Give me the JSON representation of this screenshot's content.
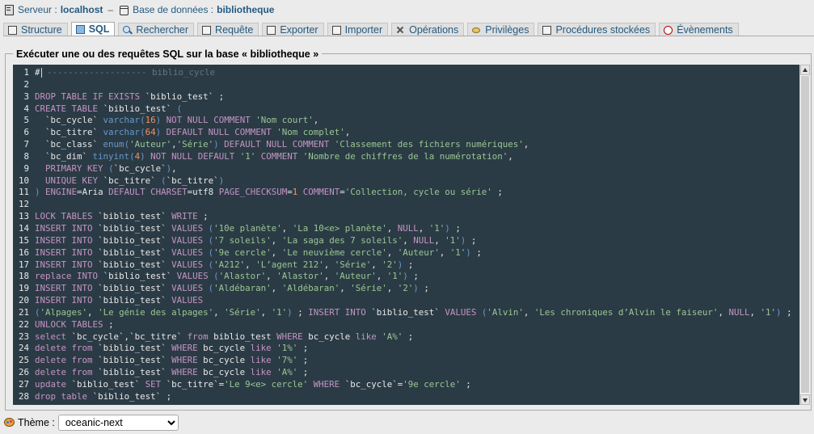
{
  "breadcrumb": {
    "server_label": "Serveur :",
    "server_value": "localhost",
    "db_label": "Base de données :",
    "db_value": "bibliotheque",
    "separator": "–"
  },
  "tabs": [
    {
      "label": "Structure",
      "icon": "structure-icon"
    },
    {
      "label": "SQL",
      "icon": "sql-icon",
      "active": true
    },
    {
      "label": "Rechercher",
      "icon": "search-icon"
    },
    {
      "label": "Requête",
      "icon": "query-icon"
    },
    {
      "label": "Exporter",
      "icon": "export-icon"
    },
    {
      "label": "Importer",
      "icon": "import-icon"
    },
    {
      "label": "Opérations",
      "icon": "operations-icon"
    },
    {
      "label": "Privilèges",
      "icon": "privileges-icon"
    },
    {
      "label": "Procédures stockées",
      "icon": "routines-icon"
    },
    {
      "label": "Évènements",
      "icon": "events-icon"
    }
  ],
  "panel": {
    "legend": "Exécuter une ou des requêtes SQL sur la base « bibliotheque »"
  },
  "editor": {
    "lines": [
      "# ------------------- biblio_cycle",
      "",
      "DROP TABLE IF EXISTS `biblio_test` ;",
      "CREATE TABLE `biblio_test` (",
      "  `bc_cycle` varchar(16) NOT NULL COMMENT 'Nom court',",
      "  `bc_titre` varchar(64) DEFAULT NULL COMMENT 'Nom complet',",
      "  `bc_class` enum('Auteur','Série') DEFAULT NULL COMMENT 'Classement des fichiers numériques',",
      "  `bc_dim` tinyint(4) NOT NULL DEFAULT '1' COMMENT 'Nombre de chiffres de la numérotation',",
      "  PRIMARY KEY (`bc_cycle`),",
      "  UNIQUE KEY `bc_titre` (`bc_titre`)",
      ") ENGINE=Aria DEFAULT CHARSET=utf8 PAGE_CHECKSUM=1 COMMENT='Collection, cycle ou série' ;",
      "",
      "LOCK TABLES `biblio_test` WRITE ;",
      "INSERT INTO `biblio_test` VALUES ('10e planète', 'La 10<e> planète', NULL, '1') ;",
      "INSERT INTO `biblio_test` VALUES ('7 soleils', 'La saga des 7 soleils', NULL, '1') ;",
      "INSERT INTO `biblio_test` VALUES ('9e cercle', 'Le neuvième cercle', 'Auteur', '1') ;",
      "INSERT INTO `biblio_test` VALUES ('A212', 'L’agent 212', 'Série', '2') ;",
      "replace INTO `biblio_test` VALUES ('Alastor', 'Alastor', 'Auteur', '1') ;",
      "INSERT INTO `biblio_test` VALUES ('Aldébaran', 'Aldébaran', 'Série', '2') ;",
      "INSERT INTO `biblio_test` VALUES",
      "('Alpages', 'Le génie des alpages', 'Série', '1') ; INSERT INTO `biblio_test` VALUES ('Alvin', 'Les chroniques d’Alvin le faiseur', NULL, '1') ;",
      "UNLOCK TABLES ;",
      "select `bc_cycle`,`bc_titre` from biblio_test WHERE bc_cycle like 'A%' ;",
      "delete from `biblio_test` WHERE bc_cycle like '1%' ;",
      "delete from `biblio_test` WHERE bc_cycle like '7%' ;",
      "delete from `biblio_test` WHERE bc_cycle like 'A%' ;",
      "update `biblio_test` SET `bc_titre`='Le 9<e> cercle' WHERE `bc_cycle`='9e cercle' ;",
      "drop table `biblio_test` ;"
    ]
  },
  "theme": {
    "label": "Thème :",
    "selected": "oceanic-next"
  },
  "colors": {
    "editor_bg": "#2b3b45",
    "keyword": "#c594c5",
    "string": "#99c794",
    "number": "#f99157",
    "type": "#6699cc",
    "comment": "#65737e",
    "text": "#e8e8e8",
    "link": "#235a81"
  }
}
